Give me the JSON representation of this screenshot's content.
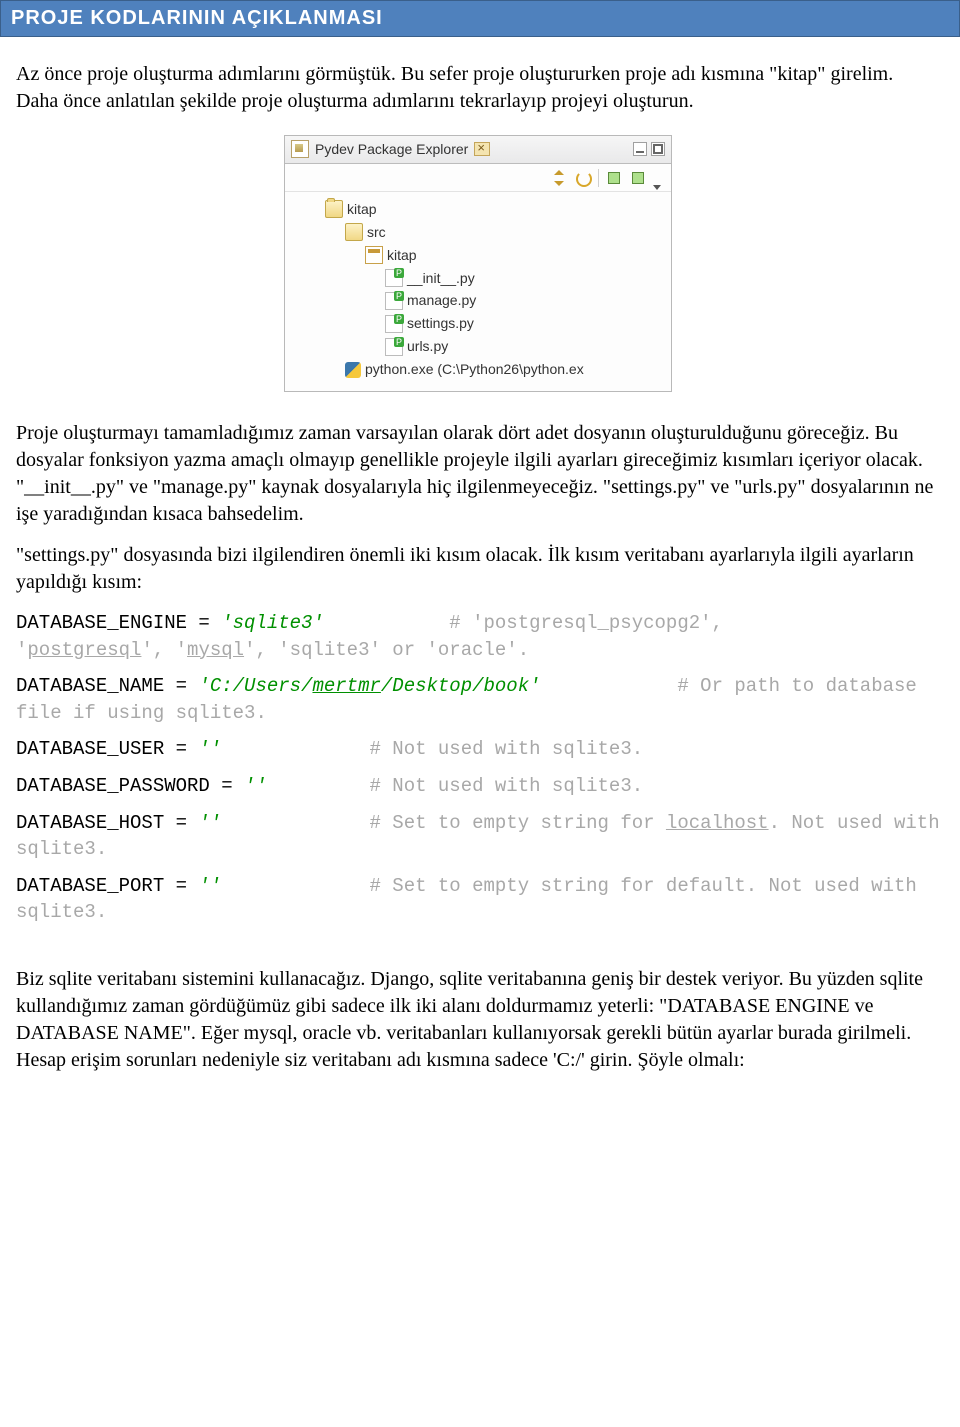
{
  "header": {
    "title": "PROJE KODLARININ AÇIKLANMASI"
  },
  "para": {
    "p1": "Az önce proje oluşturma adımlarını görmüştük. Bu sefer proje oluştururken proje adı kısmına \"kitap\" girelim. Daha önce anlatılan şekilde proje oluşturma adımlarını tekrarlayıp projeyi oluşturun.",
    "p2": "Proje oluşturmayı tamamladığımız zaman varsayılan olarak dört adet dosyanın oluşturulduğunu göreceğiz. Bu dosyalar fonksiyon yazma amaçlı olmayıp genellikle projeyle ilgili ayarları gireceğimiz kısımları içeriyor olacak. \"__init__.py\" ve \"manage.py\" kaynak dosyalarıyla hiç ilgilenmeyeceğiz. \"settings.py\" ve \"urls.py\" dosyalarının ne işe yaradığından kısaca bahsedelim.",
    "p3": "\"settings.py\" dosyasında bizi ilgilendiren önemli iki kısım olacak. İlk kısım veritabanı ayarlarıyla ilgili ayarların yapıldığı kısım:",
    "p4": "Biz sqlite veritabanı sistemini kullanacağız. Django, sqlite veritabanına geniş bir destek veriyor. Bu yüzden sqlite kullandığımız zaman gördüğümüz gibi sadece ilk iki alanı doldurmamız yeterli: \"DATABASE ENGINE ve DATABASE NAME\". Eğer mysql, oracle vb. veritabanları kullanıyorsak gerekli bütün ayarlar burada girilmeli. Hesap erişim sorunları nedeniyle siz veritabanı adı kısmına sadece 'C:/' girin. Şöyle olmalı:"
  },
  "ide": {
    "tab_title": "Pydev Package Explorer",
    "tree": {
      "root": "kitap",
      "src": "src",
      "pkg": "kitap",
      "f1": "__init__.py",
      "f2": "manage.py",
      "f3": "settings.py",
      "f4": "urls.py",
      "python": "python.exe  (C:\\Python26\\python.ex"
    }
  },
  "code": {
    "engine_l": "DATABASE_ENGINE = ",
    "engine_v": "'sqlite3'",
    "engine_c1": "# 'postgresql_psycopg2', ",
    "engine_c2a": "'",
    "engine_c2b": "postgresql",
    "engine_c2c": "', '",
    "engine_c2d": "mysql",
    "engine_c2e": "', 'sqlite3' or 'oracle'.",
    "name_l": "DATABASE_NAME = ",
    "name_v1": "'C:/Users/",
    "name_v2": "mertmr",
    "name_v3": "/Desktop/book'",
    "name_c": "# Or path to database file if using sqlite3.",
    "user_l": "DATABASE_USER = ",
    "q": "''",
    "user_c": "# Not used with sqlite3.",
    "pass_l": "DATABASE_PASSWORD = ",
    "pass_c": "# Not used with sqlite3.",
    "host_l": "DATABASE_HOST = ",
    "host_c1": "# Set to empty string for ",
    "host_c2": "localhost",
    "host_c3": ". Not used with sqlite3.",
    "port_l": "DATABASE_PORT = ",
    "port_c": "# Set to empty string for default. Not used with sqlite3."
  }
}
